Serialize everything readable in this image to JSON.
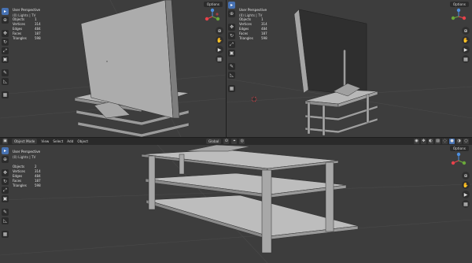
{
  "viewports": [
    {
      "info": {
        "perspective": "User Perspective",
        "collection": "(0) Lights | TV"
      },
      "stats": [
        {
          "label": "Objects",
          "value": "1"
        },
        {
          "label": "Vertices",
          "value": "314"
        },
        {
          "label": "Edges",
          "value": "484"
        },
        {
          "label": "Faces",
          "value": "187"
        },
        {
          "label": "Triangles",
          "value": "598"
        }
      ]
    },
    {
      "info": {
        "perspective": "User Perspective",
        "collection": "(0) Lights | TV"
      },
      "stats": [
        {
          "label": "Objects",
          "value": "1"
        },
        {
          "label": "Vertices",
          "value": "314"
        },
        {
          "label": "Edges",
          "value": "484"
        },
        {
          "label": "Faces",
          "value": "187"
        },
        {
          "label": "Triangles",
          "value": "598"
        }
      ]
    },
    {
      "info": {
        "perspective": "User Perspective",
        "collection": "(0) Lights | TV"
      },
      "stats": [
        {
          "label": "Objects",
          "value": "2"
        },
        {
          "label": "Vertices",
          "value": "314"
        },
        {
          "label": "Edges",
          "value": "484"
        },
        {
          "label": "Faces",
          "value": "187"
        },
        {
          "label": "Triangles",
          "value": "598"
        }
      ]
    }
  ],
  "options_label": "Options",
  "header": {
    "mode": "Object Mode",
    "menus": [
      "View",
      "Select",
      "Add",
      "Object"
    ],
    "orientation": "Global"
  },
  "colors": {
    "viewport_bg": "#3d3d3d",
    "active_tool": "#4772b3",
    "x_axis": "#e8424a",
    "y_axis": "#6aa83a",
    "z_axis": "#4d8fe0"
  }
}
